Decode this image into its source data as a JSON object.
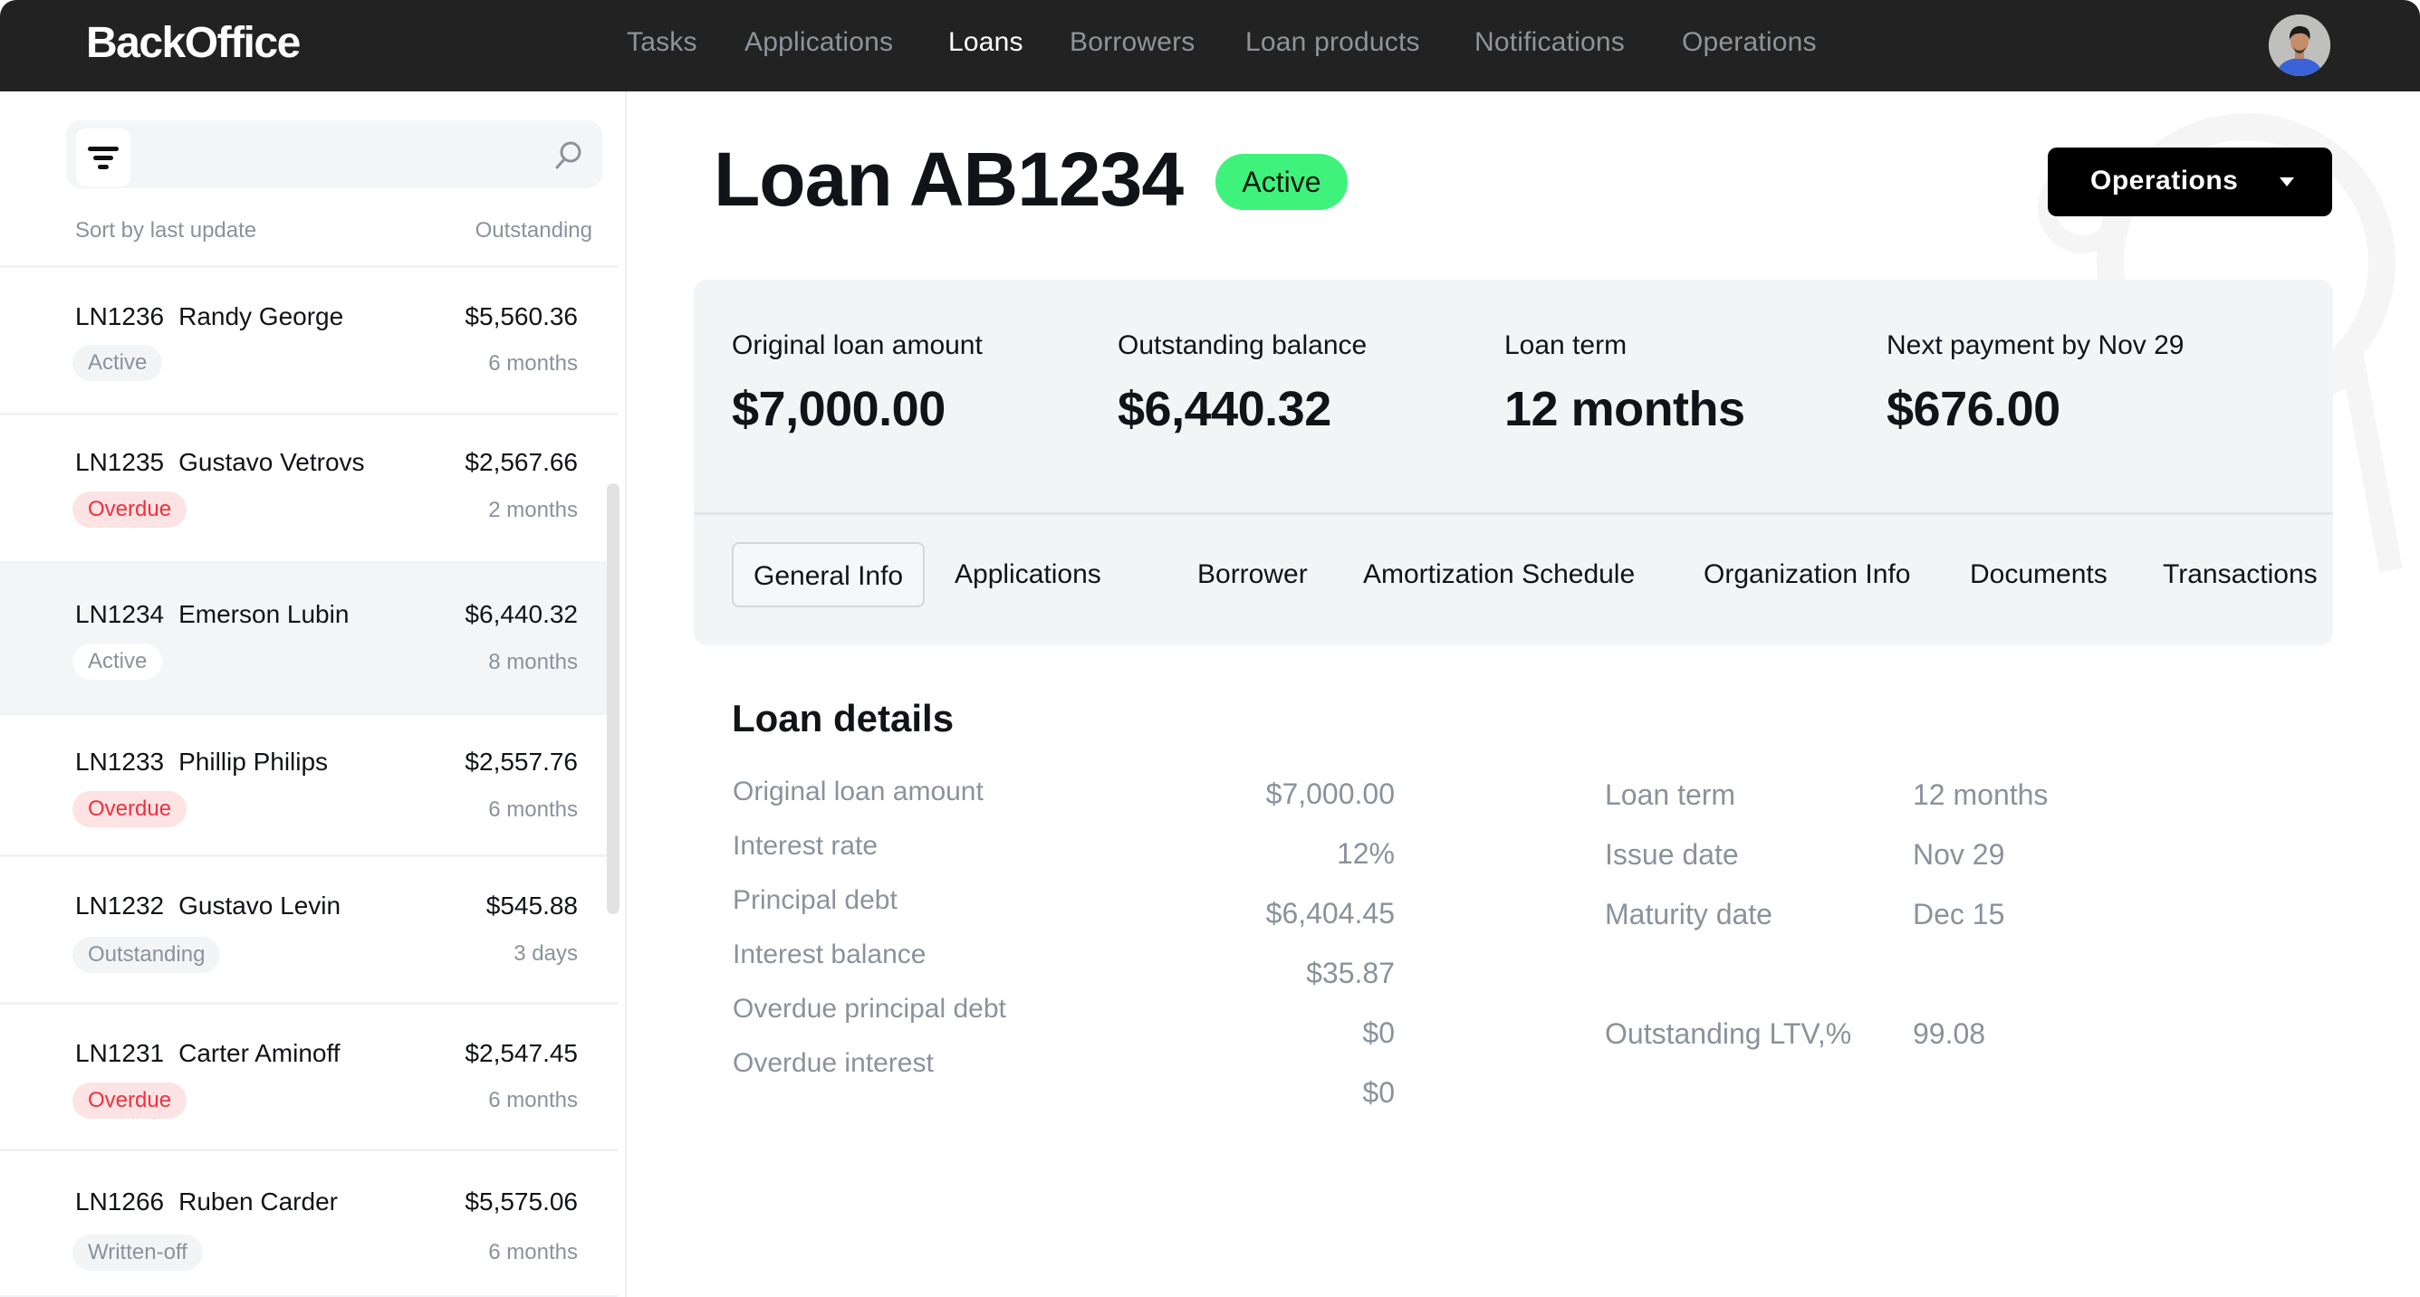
{
  "app": {
    "logo": "BackOffice",
    "nav": [
      {
        "label": "Tasks",
        "active": false
      },
      {
        "label": "Applications",
        "active": false
      },
      {
        "label": "Loans",
        "active": true
      },
      {
        "label": "Borrowers",
        "active": false
      },
      {
        "label": "Loan products",
        "active": false
      },
      {
        "label": "Notifications",
        "active": false
      },
      {
        "label": "Operations",
        "active": false
      }
    ],
    "avatar_icon": "user-avatar"
  },
  "sidebar": {
    "filter_icon": "filter-icon",
    "search_icon": "search-icon",
    "search_value": "",
    "sort_label": "Sort by last update",
    "column_label": "Outstanding",
    "loans": [
      {
        "id": "LN1236",
        "name": "Randy George",
        "amount": "$5,560.36",
        "status": "Active",
        "term": "6 months",
        "selected": false
      },
      {
        "id": "LN1235",
        "name": "Gustavo Vetrovs",
        "amount": "$2,567.66",
        "status": "Overdue",
        "term": "2 months",
        "selected": false
      },
      {
        "id": "LN1234",
        "name": "Emerson Lubin",
        "amount": "$6,440.32",
        "status": "Active",
        "term": "8 months",
        "selected": true
      },
      {
        "id": "LN1233",
        "name": "Phillip Philips",
        "amount": "$2,557.76",
        "status": "Overdue",
        "term": "6 months",
        "selected": false
      },
      {
        "id": "LN1232",
        "name": "Gustavo Levin",
        "amount": "$545.88",
        "status": "Outstanding",
        "term": "3 days",
        "selected": false
      },
      {
        "id": "LN1231",
        "name": "Carter Aminoff",
        "amount": "$2,547.45",
        "status": "Overdue",
        "term": "6 months",
        "selected": false
      },
      {
        "id": "LN1266",
        "name": "Ruben Carder",
        "amount": "$5,575.06",
        "status": "Written-off",
        "term": "6 months",
        "selected": false
      }
    ]
  },
  "main": {
    "title": "Loan AB1234",
    "status": "Active",
    "status_color": "#3ff27c",
    "operations_button": "Operations",
    "summary": [
      {
        "label": "Original loan amount",
        "value": "$7,000.00"
      },
      {
        "label": "Outstanding balance",
        "value": "$6,440.32"
      },
      {
        "label": "Loan term",
        "value": "12 months"
      },
      {
        "label": "Next payment by Nov 29",
        "value": "$676.00"
      }
    ],
    "tabs": [
      {
        "label": "General Info",
        "active": true
      },
      {
        "label": "Applications",
        "active": false
      },
      {
        "label": "Borrower",
        "active": false
      },
      {
        "label": "Amortization Schedule",
        "active": false
      },
      {
        "label": "Organization Info",
        "active": false
      },
      {
        "label": "Documents",
        "active": false
      },
      {
        "label": "Transactions",
        "active": false
      }
    ],
    "details_title": "Loan details",
    "details_left": [
      {
        "label": "Original loan amount",
        "value": "$7,000.00"
      },
      {
        "label": "Interest rate",
        "value": "12%"
      },
      {
        "label": "Principal debt",
        "value": "$6,404.45"
      },
      {
        "label": "Interest balance",
        "value": "$35.87"
      },
      {
        "label": "Overdue principal debt",
        "value": "$0"
      },
      {
        "label": "Overdue interest",
        "value": "$0"
      }
    ],
    "details_right": [
      {
        "label": "Loan term",
        "value": "12 months"
      },
      {
        "label": "Issue date",
        "value": "Nov 29"
      },
      {
        "label": "Maturity date",
        "value": "Dec 15"
      },
      {
        "label": "Outstanding LTV,%",
        "value": "99.08"
      }
    ]
  },
  "colors": {
    "header_bg": "#222222",
    "overdue_text": "#f0303f",
    "overdue_bg": "#fde3e3",
    "muted_text": "#8a929c",
    "card_bg": "#f3f4f6"
  }
}
